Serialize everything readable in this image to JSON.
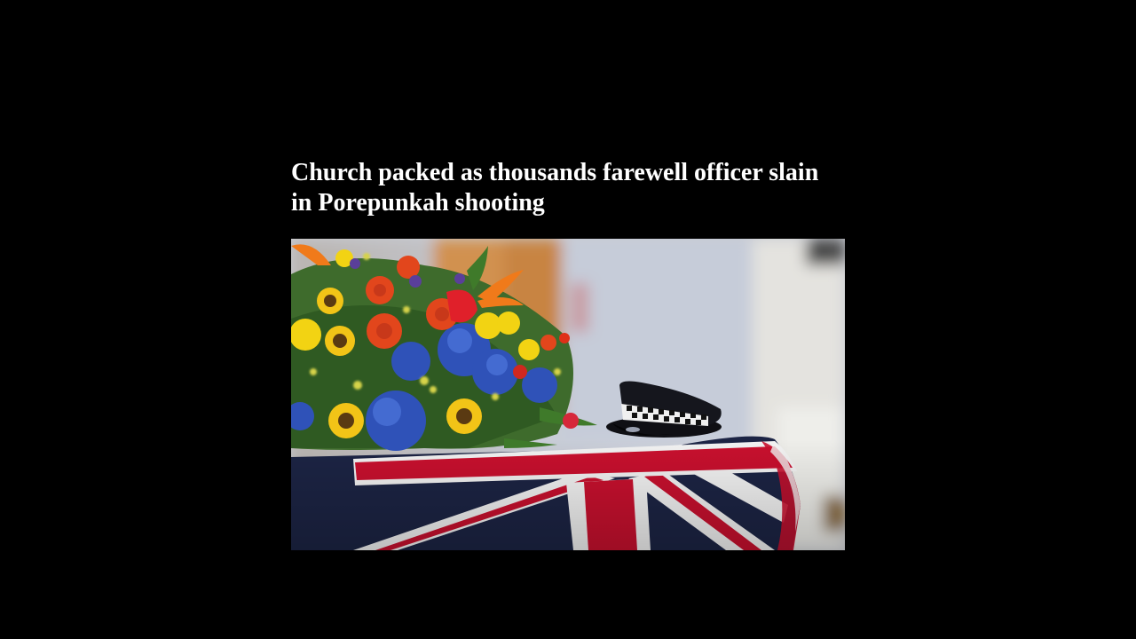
{
  "article": {
    "headline": "Church packed as thousands farewell officer slain in Porepunkah shooting"
  },
  "image": {
    "subject": "photo"
  },
  "colors": {
    "background": "#000000",
    "headline_text": "#ffffff",
    "flag_blue": "#1c2444",
    "flag_red": "#c8102e",
    "flag_white": "#f4f4f4"
  }
}
